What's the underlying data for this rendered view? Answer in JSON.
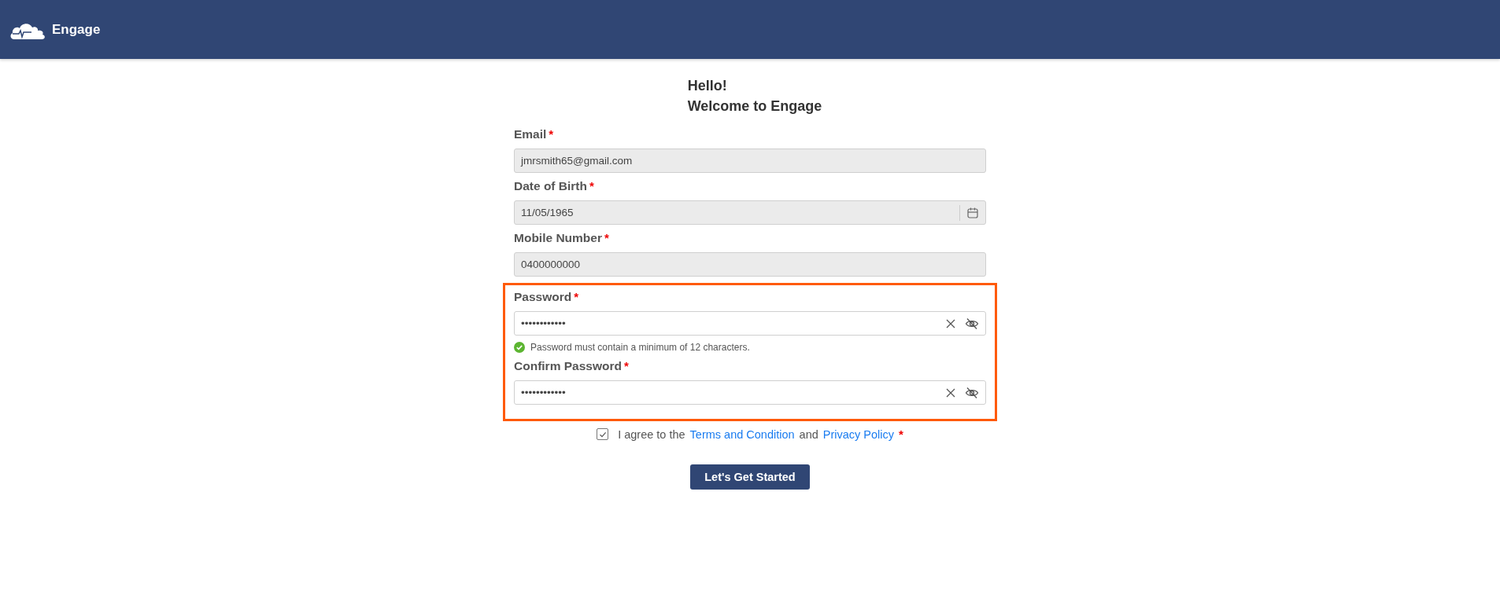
{
  "header": {
    "brand": "Engage"
  },
  "title": {
    "line1": "Hello!",
    "line2": "Welcome to Engage"
  },
  "fields": [
    {
      "kind": "text",
      "label": "Email",
      "required_mark": "*",
      "value": "jmrsmith65@gmail.com",
      "disabled": true
    },
    {
      "kind": "date",
      "label": "Date of Birth",
      "required_mark": "*",
      "value": "11/05/1965",
      "disabled": true
    },
    {
      "kind": "text",
      "label": "Mobile Number",
      "required_mark": "*",
      "value": "0400000000",
      "disabled": true
    }
  ],
  "highlighted_fields": [
    {
      "kind": "password",
      "label": "Password",
      "required_mark": "*",
      "value": "••••••••••••",
      "disabled": false,
      "hint": {
        "text": "Password must contain a minimum of 12 characters.",
        "met": true
      }
    },
    {
      "kind": "password",
      "label": "Confirm Password",
      "required_mark": "*",
      "value": "••••••••••••",
      "disabled": false
    }
  ],
  "agreement": {
    "checked": true,
    "prefix": "I agree to the",
    "link1": "Terms and Condition",
    "middle": "and",
    "link2": "Privacy Policy",
    "required_mark": "*"
  },
  "submit": {
    "label": "Let's Get Started"
  }
}
